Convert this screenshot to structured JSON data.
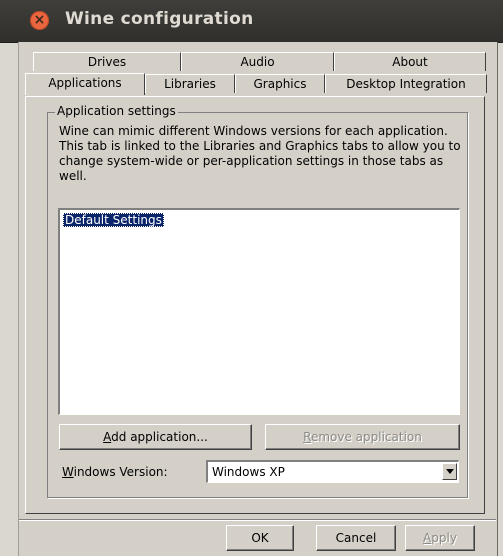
{
  "window": {
    "title": "Wine configuration",
    "close_glyph": "×"
  },
  "tabs": {
    "back_row": [
      "Drives",
      "Audio",
      "About"
    ],
    "front_row": [
      "Applications",
      "Libraries",
      "Graphics",
      "Desktop Integration"
    ],
    "active": "Applications"
  },
  "group": {
    "legend": "Application settings",
    "description": "Wine can mimic different Windows versions for each application. This tab is linked to the Libraries and Graphics tabs to allow you to change system-wide or per-application settings in those tabs as well."
  },
  "app_list": {
    "items": [
      "Default Settings"
    ],
    "selected_index": 0
  },
  "buttons": {
    "add_mnemonic": "A",
    "add_rest": "dd application...",
    "remove_mnemonic": "R",
    "remove_rest": "emove application",
    "ok": "OK",
    "cancel": "Cancel",
    "apply_mnemonic": "A",
    "apply_rest": "pply"
  },
  "windows_version": {
    "label_mnemonic": "W",
    "label_rest": "indows Version:",
    "value": "Windows XP"
  },
  "colors": {
    "selection": "#0a246a",
    "close_button": "#e9663f"
  }
}
